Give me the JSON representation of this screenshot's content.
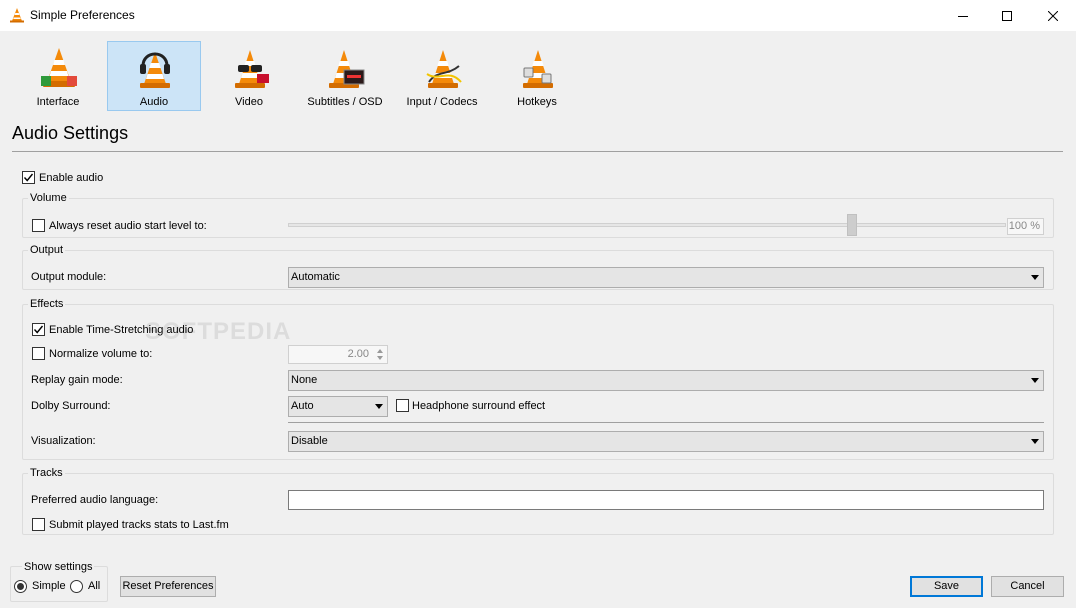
{
  "window": {
    "title": "Simple Preferences",
    "minimize_icon": "minimize-icon",
    "maximize_icon": "maximize-icon",
    "close_icon": "close-icon"
  },
  "categories": [
    {
      "label": "Interface",
      "icon": "vlc-cone-interface-icon",
      "selected": false
    },
    {
      "label": "Audio",
      "icon": "vlc-cone-headphones-icon",
      "selected": true
    },
    {
      "label": "Video",
      "icon": "vlc-cone-glasses-icon",
      "selected": false
    },
    {
      "label": "Subtitles / OSD",
      "icon": "vlc-cone-subtitles-icon",
      "selected": false
    },
    {
      "label": "Input / Codecs",
      "icon": "vlc-cone-cables-icon",
      "selected": false
    },
    {
      "label": "Hotkeys",
      "icon": "vlc-cone-keyboard-icon",
      "selected": false
    }
  ],
  "page": {
    "heading": "Audio Settings",
    "watermark": "SOFTPEDIA"
  },
  "enable_audio": {
    "label": "Enable audio",
    "checked": true
  },
  "volume": {
    "group_title": "Volume",
    "reset_label": "Always reset audio start level to:",
    "reset_checked": false,
    "level_value": "100 %",
    "level_fraction": 0.79
  },
  "output": {
    "group_title": "Output",
    "module_label": "Output module:",
    "module_value": "Automatic"
  },
  "effects": {
    "group_title": "Effects",
    "time_stretch_label": "Enable Time-Stretching audio",
    "time_stretch_checked": true,
    "normalize_label": "Normalize volume to:",
    "normalize_checked": false,
    "normalize_value": "2.00",
    "replay_gain_label": "Replay gain mode:",
    "replay_gain_value": "None",
    "dolby_label": "Dolby Surround:",
    "dolby_value": "Auto",
    "headphone_label": "Headphone surround effect",
    "headphone_checked": false,
    "visualization_label": "Visualization:",
    "visualization_value": "Disable"
  },
  "tracks": {
    "group_title": "Tracks",
    "language_label": "Preferred audio language:",
    "language_value": "",
    "lastfm_label": "Submit played tracks stats to Last.fm",
    "lastfm_checked": false
  },
  "footer": {
    "show_settings_title": "Show settings",
    "simple_label": "Simple",
    "all_label": "All",
    "selected_mode": "Simple",
    "reset_button": "Reset Preferences",
    "save_button": "Save",
    "cancel_button": "Cancel"
  },
  "colors": {
    "selected_tab_bg": "#cce4f7",
    "default_button_border": "#0078d7",
    "window_bg": "#f0f0f0"
  }
}
